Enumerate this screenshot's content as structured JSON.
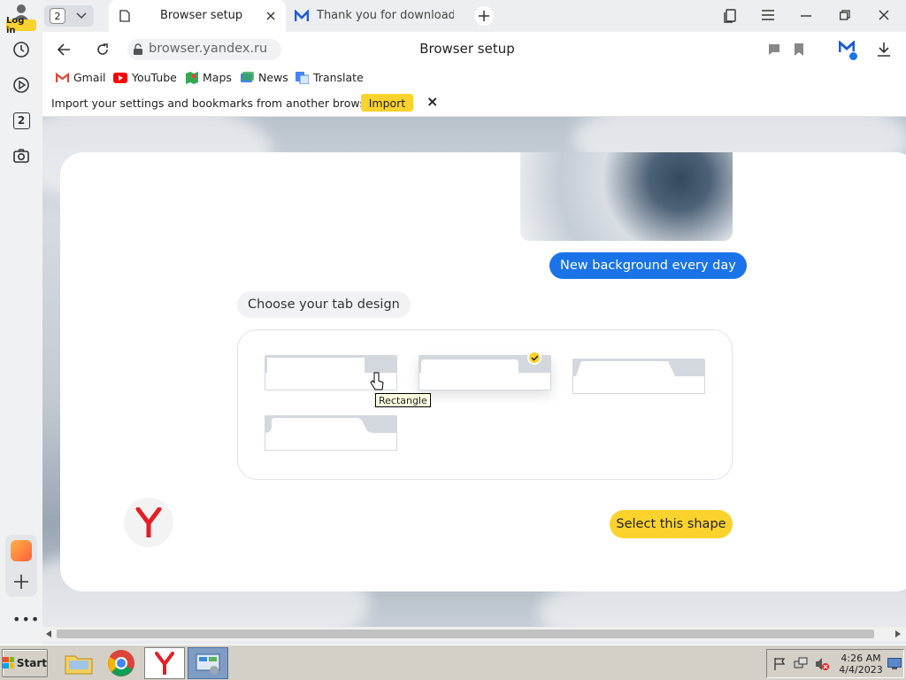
{
  "sidebar": {
    "login_label": "Log in",
    "counter_badge": "2"
  },
  "tabs": {
    "count": "2",
    "active_title": "Browser setup",
    "second_title": "Thank you for downloadin"
  },
  "toolbar": {
    "url": "browser.yandex.ru",
    "page_title": "Browser setup"
  },
  "bookmarks": [
    {
      "label": "Gmail",
      "icon": "gmail-icon",
      "color": "#ea4335"
    },
    {
      "label": "YouTube",
      "icon": "youtube-icon",
      "color": "#ff0000"
    },
    {
      "label": "Maps",
      "icon": "maps-icon",
      "color": "#34a853"
    },
    {
      "label": "News",
      "icon": "news-icon",
      "color": "#4285f4"
    },
    {
      "label": "Translate",
      "icon": "translate-icon",
      "color": "#4285f4"
    }
  ],
  "infobar": {
    "message": "Import your settings and bookmarks from another browser.",
    "import_label": "Import",
    "close_glyph": "×"
  },
  "setup": {
    "new_background": "New background every day",
    "choose_design": "Choose your tab design",
    "select_button": "Select this shape",
    "tooltip": "Rectangle",
    "selected_shape_index": 2
  },
  "taskbar": {
    "start_label": "Start",
    "time": "4:26 AM",
    "date": "4/4/2023"
  },
  "colors": {
    "accent_blue": "#1a73e8",
    "accent_yellow": "#fcd22d"
  }
}
